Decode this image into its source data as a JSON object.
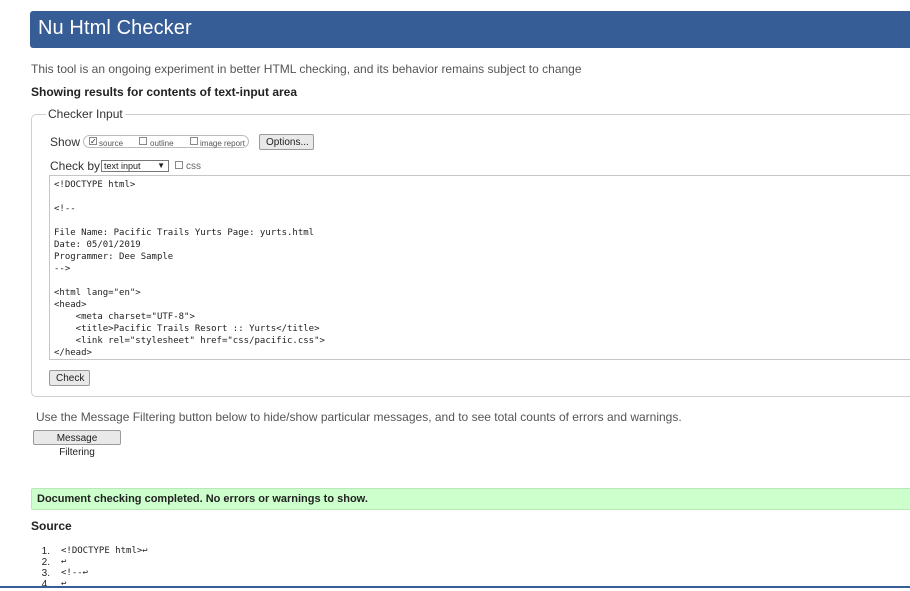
{
  "header": {
    "title": "Nu Html Checker"
  },
  "intro": "This tool is an ongoing experiment in better HTML checking, and its behavior remains subject to change",
  "showing": "Showing results for contents of text-input area",
  "checker_input": {
    "legend": "Checker Input",
    "show_label": "Show",
    "show_options": [
      {
        "label": "source",
        "checked": true
      },
      {
        "label": "outline",
        "checked": false
      },
      {
        "label": "image report",
        "checked": false
      }
    ],
    "options_button": "Options...",
    "check_by_label": "Check by",
    "check_by_value": "text input",
    "css_label": "css",
    "source_text": "<!DOCTYPE html>\n\n<!--\n\nFile Name: Pacific Trails Yurts Page: yurts.html\nDate: 05/01/2019\nProgrammer: Dee Sample\n-->\n\n<html lang=\"en\">\n<head>\n    <meta charset=\"UTF-8\">\n    <title>Pacific Trails Resort :: Yurts</title>\n    <link rel=\"stylesheet\" href=\"css/pacific.css\">\n</head>",
    "check_button": "Check"
  },
  "filtering": {
    "text": "Use the Message Filtering button below to hide/show particular messages, and to see total counts of errors and warnings.",
    "button": "Message Filtering"
  },
  "result": {
    "message": "Document checking completed. No errors or warnings to show."
  },
  "source": {
    "heading": "Source",
    "lines": [
      {
        "num": "1.",
        "code": "<!DOCTYPE html>↩"
      },
      {
        "num": "2.",
        "code": "↩"
      },
      {
        "num": "3.",
        "code": "<!--↩"
      },
      {
        "num": "4.",
        "code": "↩"
      }
    ]
  },
  "colors": {
    "banner": "#365d95",
    "success_bg": "#ccffcc"
  }
}
